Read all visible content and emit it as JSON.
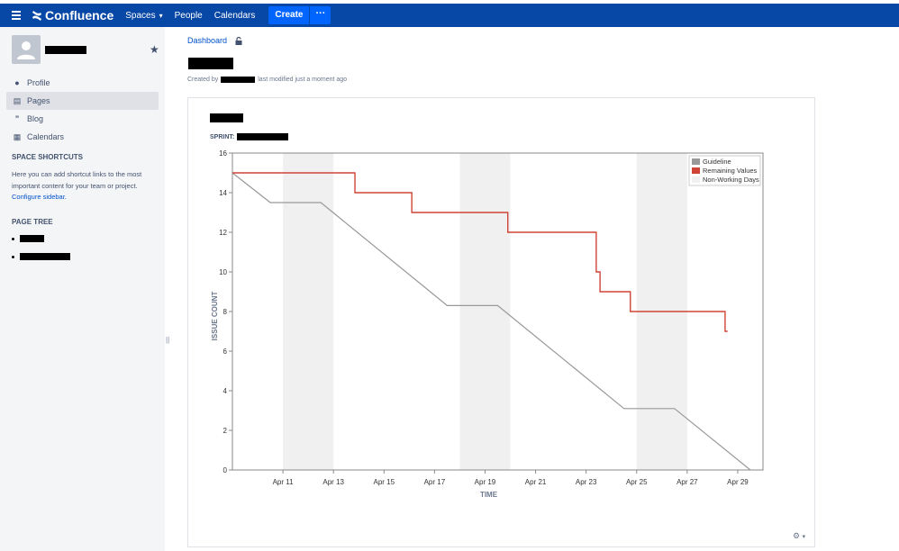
{
  "topbar": {
    "product": "Confluence",
    "nav": [
      "Spaces",
      "People",
      "Calendars"
    ],
    "create_label": "Create",
    "more_label": "···"
  },
  "sidebar": {
    "items": [
      {
        "label": "Profile",
        "icon": "person-icon"
      },
      {
        "label": "Pages",
        "icon": "page-icon"
      },
      {
        "label": "Blog",
        "icon": "quote-icon"
      },
      {
        "label": "Calendars",
        "icon": "calendar-icon"
      }
    ],
    "shortcuts_heading": "SPACE SHORTCUTS",
    "shortcuts_text": "Here you can add shortcut links to the most important content for your team or project.",
    "configure_link": "Configure sidebar.",
    "page_tree_heading": "PAGE TREE"
  },
  "page": {
    "breadcrumb": "Dashboard",
    "created_by": "Created by",
    "last_modified": "last modified just a moment ago"
  },
  "gadget": {
    "sprint_label": "SPRINT:"
  },
  "chart_data": {
    "type": "line",
    "xlabel": "TIME",
    "ylabel": "ISSUE COUNT",
    "xlim": [
      "Apr 9",
      "Apr 30"
    ],
    "ylim": [
      0,
      16
    ],
    "yticks": [
      0,
      2,
      4,
      6,
      8,
      10,
      12,
      14,
      16
    ],
    "xticks": [
      "Apr 11",
      "Apr 13",
      "Apr 15",
      "Apr 17",
      "Apr 19",
      "Apr 21",
      "Apr 23",
      "Apr 25",
      "Apr 27",
      "Apr 29"
    ],
    "legend_position": "top-right",
    "legend": [
      {
        "name": "Guideline",
        "color": "#999999"
      },
      {
        "name": "Remaining Values",
        "color": "#d04437"
      },
      {
        "name": "Non-Working Days",
        "color": "#f0f0f0"
      }
    ],
    "non_working_days": [
      [
        "Apr 11",
        "Apr 13"
      ],
      [
        "Apr 18",
        "Apr 20"
      ],
      [
        "Apr 25",
        "Apr 27"
      ]
    ],
    "series": [
      {
        "name": "Guideline",
        "color": "#999999",
        "points": [
          [
            "Apr 9",
            15
          ],
          [
            "Apr 10.5",
            13.5
          ],
          [
            "Apr 12.5",
            13.5
          ],
          [
            "Apr 17.5",
            8.3
          ],
          [
            "Apr 19.5",
            8.3
          ],
          [
            "Apr 24.5",
            3.1
          ],
          [
            "Apr 26.5",
            3.1
          ],
          [
            "Apr 29.5",
            0
          ]
        ]
      },
      {
        "name": "Remaining Values",
        "color": "#d04437",
        "step": true,
        "points": [
          [
            "Apr 9",
            15
          ],
          [
            "Apr 13.85",
            15
          ],
          [
            "Apr 13.85",
            14
          ],
          [
            "Apr 16.1",
            14
          ],
          [
            "Apr 16.1",
            13
          ],
          [
            "Apr 19.9",
            13
          ],
          [
            "Apr 19.9",
            12
          ],
          [
            "Apr 23.4",
            12
          ],
          [
            "Apr 23.4",
            10
          ],
          [
            "Apr 23.55",
            10
          ],
          [
            "Apr 23.55",
            9
          ],
          [
            "Apr 24.75",
            9
          ],
          [
            "Apr 24.75",
            8
          ],
          [
            "Apr 28.5",
            8
          ],
          [
            "Apr 28.5",
            7
          ],
          [
            "Apr 28.6",
            7
          ]
        ]
      }
    ]
  }
}
